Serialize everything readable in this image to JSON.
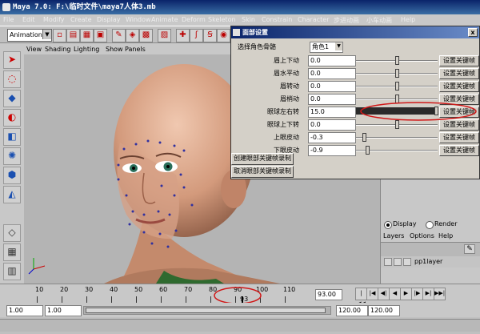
{
  "window": {
    "title": "Maya 7.0: F:\\临时文件\\maya7人体3.mb"
  },
  "menubar": [
    "File",
    "Edit",
    "Modify",
    "Create",
    "Display",
    "Window",
    "Animate",
    "Deform",
    "Skeleton",
    "Skin",
    "Constrain",
    "Character",
    "步进动画",
    "小车动画",
    "Help"
  ],
  "shelf": {
    "mode": "Animation"
  },
  "viewport_menu": [
    "View",
    "Shading",
    "Lighting",
    "Show",
    "Panels"
  ],
  "dialog": {
    "title": "面部设置",
    "close_label": "x",
    "role_label": "选择角色骨骼",
    "role_value": "角色1",
    "rows": [
      {
        "label": "眉上下动",
        "value": "0.0",
        "slider": 0.5,
        "button": "设置关键帧"
      },
      {
        "label": "眉水平动",
        "value": "0.0",
        "slider": 0.5,
        "button": "设置关键帧"
      },
      {
        "label": "眉转动",
        "value": "0.0",
        "slider": 0.5,
        "button": "设置关键帧"
      },
      {
        "label": "眉梢动",
        "value": "0.0",
        "slider": 0.5,
        "button": "设置关键帧"
      },
      {
        "label": "眼球左右转",
        "value": "15.0",
        "slider": 0.97,
        "button": "设置关键帧"
      },
      {
        "label": "眼球上下转",
        "value": "0.0",
        "slider": 0.5,
        "button": "设置关键帧"
      },
      {
        "label": "上眼皮动",
        "value": "-0.3",
        "slider": 0.08,
        "button": "设置关键帧"
      },
      {
        "label": "下眼皮动",
        "value": "-0.9",
        "slider": 0.12,
        "button": "设置关键帧"
      }
    ],
    "create_btn": "创建眼部关键帧录制",
    "cancel_btn": "取消眼部关键帧录制"
  },
  "layer_editor": {
    "display": "Display",
    "render": "Render",
    "menus": [
      "Layers",
      "Options",
      "Help"
    ],
    "layer_name": "pp1layer"
  },
  "timeline": {
    "ticks": [
      "10",
      "20",
      "30",
      "40",
      "50",
      "60",
      "70",
      "80",
      "90",
      "100",
      "110"
    ],
    "current_frame": "93",
    "end_field": "93.00"
  },
  "range": {
    "start": "1.00",
    "start2": "1.00",
    "end": "120.00",
    "end2": "120.00"
  },
  "colors": {
    "accent_red": "#d01818",
    "title_blue": "#0a246a",
    "skin": "#d9a88c"
  }
}
